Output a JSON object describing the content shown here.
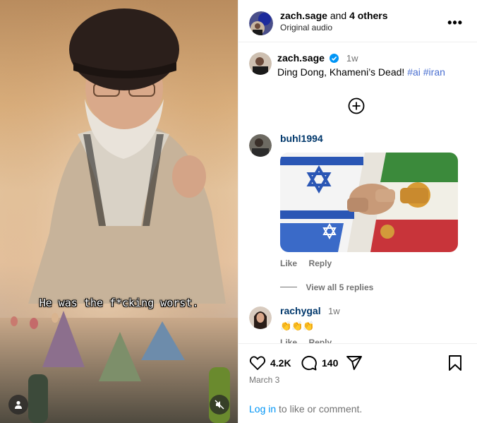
{
  "video": {
    "subtitle": "He was the f*cking worst."
  },
  "header": {
    "author": "zach.sage",
    "and_text": "and",
    "others": "4 others",
    "audio": "Original audio"
  },
  "caption": {
    "user": "zach.sage",
    "time": "1w",
    "text": "Ding Dong, Khameni’s Dead!",
    "tag1": "#ai",
    "tag2": "#iran"
  },
  "comments": [
    {
      "user": "buhl1994",
      "like": "Like",
      "reply": "Reply",
      "view_replies": "View all 5 replies"
    },
    {
      "user": "rachygal",
      "time": "1w",
      "text": "👏👏👏",
      "like": "Like",
      "reply": "Reply"
    }
  ],
  "footer": {
    "likes": "4.2K",
    "comments": "140",
    "date": "March 3",
    "login_link": "Log in",
    "login_rest": "to like or comment."
  },
  "colors": {
    "link_blue": "#00376b",
    "hashtag": "#4a6fd0",
    "login_blue": "#0095f6",
    "muted": "#737373",
    "verified": "#0095f6"
  },
  "icons": [
    "user-icon",
    "muted-speaker-icon",
    "more-icon",
    "verified-icon",
    "add-comment-icon",
    "heart-icon",
    "comment-icon",
    "share-icon",
    "bookmark-icon"
  ]
}
